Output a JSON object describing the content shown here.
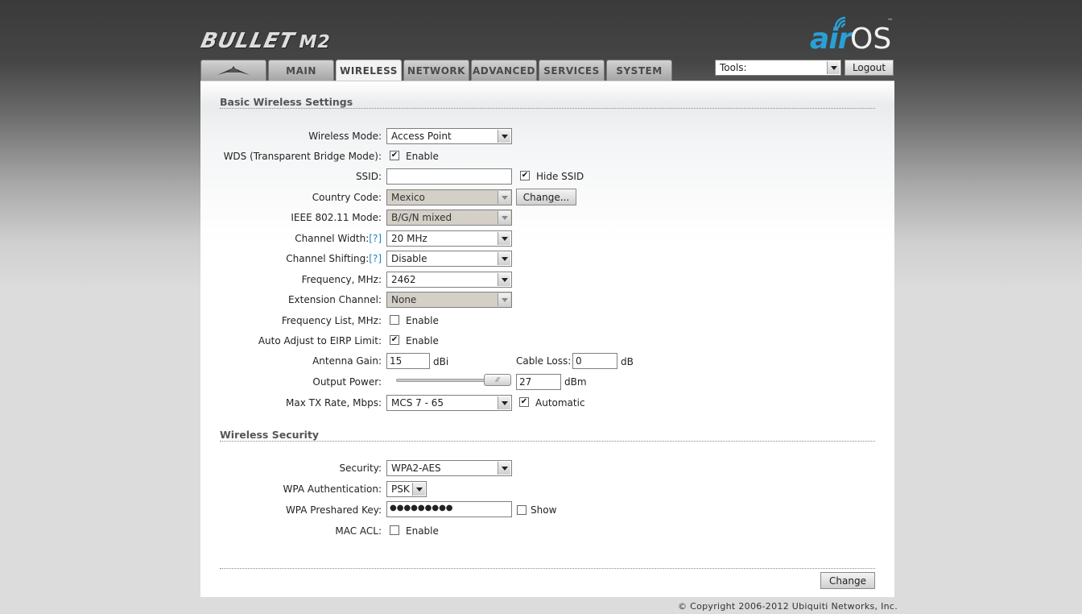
{
  "branding": {
    "product": "BULLET",
    "model": "M2",
    "os_air": "air",
    "os_os": "OS",
    "tm": "™"
  },
  "tabs": [
    {
      "label": "",
      "icon": "ubiquiti-logo-icon"
    },
    {
      "label": "MAIN"
    },
    {
      "label": "WIRELESS",
      "active": true
    },
    {
      "label": "NETWORK"
    },
    {
      "label": "ADVANCED"
    },
    {
      "label": "SERVICES"
    },
    {
      "label": "SYSTEM"
    }
  ],
  "tools": {
    "value": "Tools:",
    "logout": "Logout"
  },
  "basic": {
    "title": "Basic Wireless Settings",
    "wireless_mode": {
      "label": "Wireless Mode:",
      "value": "Access Point"
    },
    "wds": {
      "label": "WDS (Transparent Bridge Mode):",
      "checked": true,
      "text": "Enable"
    },
    "ssid": {
      "label": "SSID:",
      "value": "",
      "hide_checked": true,
      "hide_text": "Hide SSID"
    },
    "country": {
      "label": "Country Code:",
      "value": "Mexico",
      "button": "Change..."
    },
    "ieee": {
      "label": "IEEE 802.11 Mode:",
      "value": "B/G/N mixed"
    },
    "channel_width": {
      "label": "Channel Width:",
      "help": "[?]",
      "value": "20 MHz"
    },
    "channel_shifting": {
      "label": "Channel Shifting:",
      "help": "[?]",
      "value": "Disable"
    },
    "frequency": {
      "label": "Frequency, MHz:",
      "value": "2462"
    },
    "extension": {
      "label": "Extension Channel:",
      "value": "None"
    },
    "freq_list": {
      "label": "Frequency List, MHz:",
      "checked": false,
      "text": "Enable"
    },
    "auto_adjust": {
      "label": "Auto Adjust to EIRP Limit:",
      "checked": true,
      "text": "Enable"
    },
    "antenna_gain": {
      "label": "Antenna Gain:",
      "value": "15",
      "unit": "dBi"
    },
    "cable_loss": {
      "label": "Cable Loss:",
      "value": "0",
      "unit": "dB"
    },
    "output_power": {
      "label": "Output Power:",
      "value": "27",
      "unit": "dBm"
    },
    "max_tx": {
      "label": "Max TX Rate, Mbps:",
      "value": "MCS 7 - 65",
      "auto_checked": true,
      "auto_text": "Automatic"
    }
  },
  "security": {
    "title": "Wireless Security",
    "security": {
      "label": "Security:",
      "value": "WPA2-AES"
    },
    "wpa_auth": {
      "label": "WPA Authentication:",
      "value": "PSK"
    },
    "wpa_key": {
      "label": "WPA Preshared Key:",
      "value": "●●●●●●●●●",
      "show_checked": false,
      "show_text": "Show"
    },
    "mac_acl": {
      "label": "MAC ACL:",
      "checked": false,
      "text": "Enable"
    }
  },
  "footer": {
    "change_button": "Change",
    "copyright": "© Copyright 2006-2012 Ubiquiti Networks, Inc."
  }
}
